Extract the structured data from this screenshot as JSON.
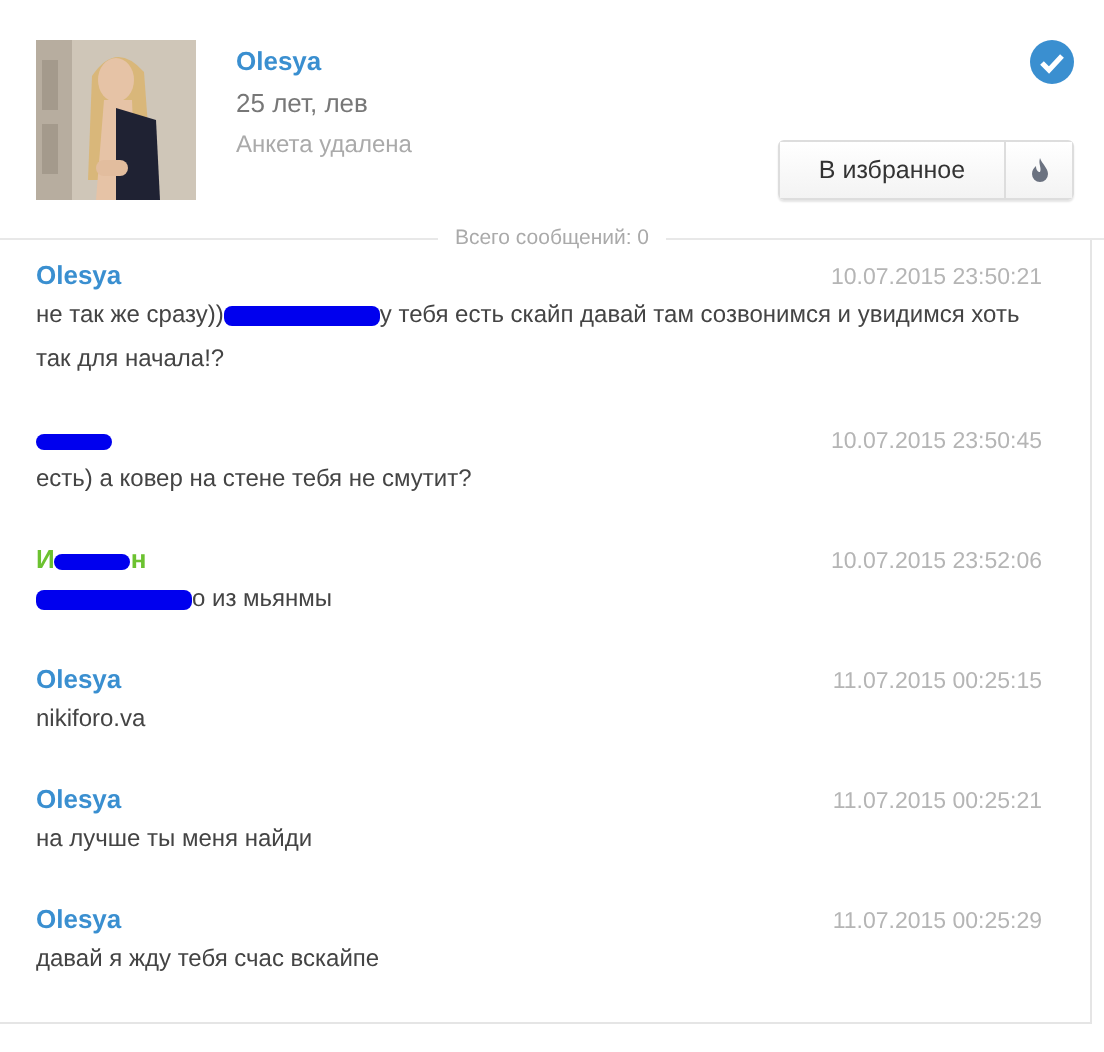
{
  "profile": {
    "name": "Olesya",
    "details": "25 лет, лев",
    "status": "Анкета удалена",
    "verified": true,
    "favorite_button": "В избранное"
  },
  "total_messages": "Всего сообщений: 0",
  "messages": [
    {
      "color": "#3a8fd0",
      "author": [
        {
          "kind": "text",
          "text": "Olesya"
        }
      ],
      "time": "10.07.2015 23:50:21",
      "text": [
        {
          "kind": "text",
          "text": "не так же сразу))"
        },
        {
          "kind": "redaction"
        },
        {
          "kind": "text",
          "text": "у тебя есть скайп давай там созвонимся и увидимся хоть так для начала!?"
        }
      ]
    },
    {
      "author": [
        {
          "kind": "redaction"
        }
      ],
      "time": "10.07.2015 23:50:45",
      "text": [
        {
          "kind": "text",
          "text": "есть) а ковер на стене тебя не смутит?"
        }
      ]
    },
    {
      "color": "#6cc230",
      "author": [
        {
          "kind": "text",
          "text": "И"
        },
        {
          "kind": "redaction"
        },
        {
          "kind": "text",
          "text": "н"
        }
      ],
      "time": "10.07.2015 23:52:06",
      "text": [
        {
          "kind": "redaction"
        },
        {
          "kind": "text",
          "text": "о из мьянмы"
        }
      ]
    },
    {
      "color": "#3a8fd0",
      "author": [
        {
          "kind": "text",
          "text": "Olesya"
        }
      ],
      "time": "11.07.2015 00:25:15",
      "text": [
        {
          "kind": "text",
          "text": "nikiforo.va"
        }
      ]
    },
    {
      "color": "#3a8fd0",
      "author": [
        {
          "kind": "text",
          "text": "Olesya"
        }
      ],
      "time": "11.07.2015 00:25:21",
      "text": [
        {
          "kind": "text",
          "text": "на лучше ты меня найди"
        }
      ]
    },
    {
      "color": "#3a8fd0",
      "author": [
        {
          "kind": "text",
          "text": "Olesya"
        }
      ],
      "time": "11.07.2015 00:25:29",
      "text": [
        {
          "kind": "text",
          "text": "давай я жду тебя счас вскайпе"
        }
      ]
    }
  ]
}
